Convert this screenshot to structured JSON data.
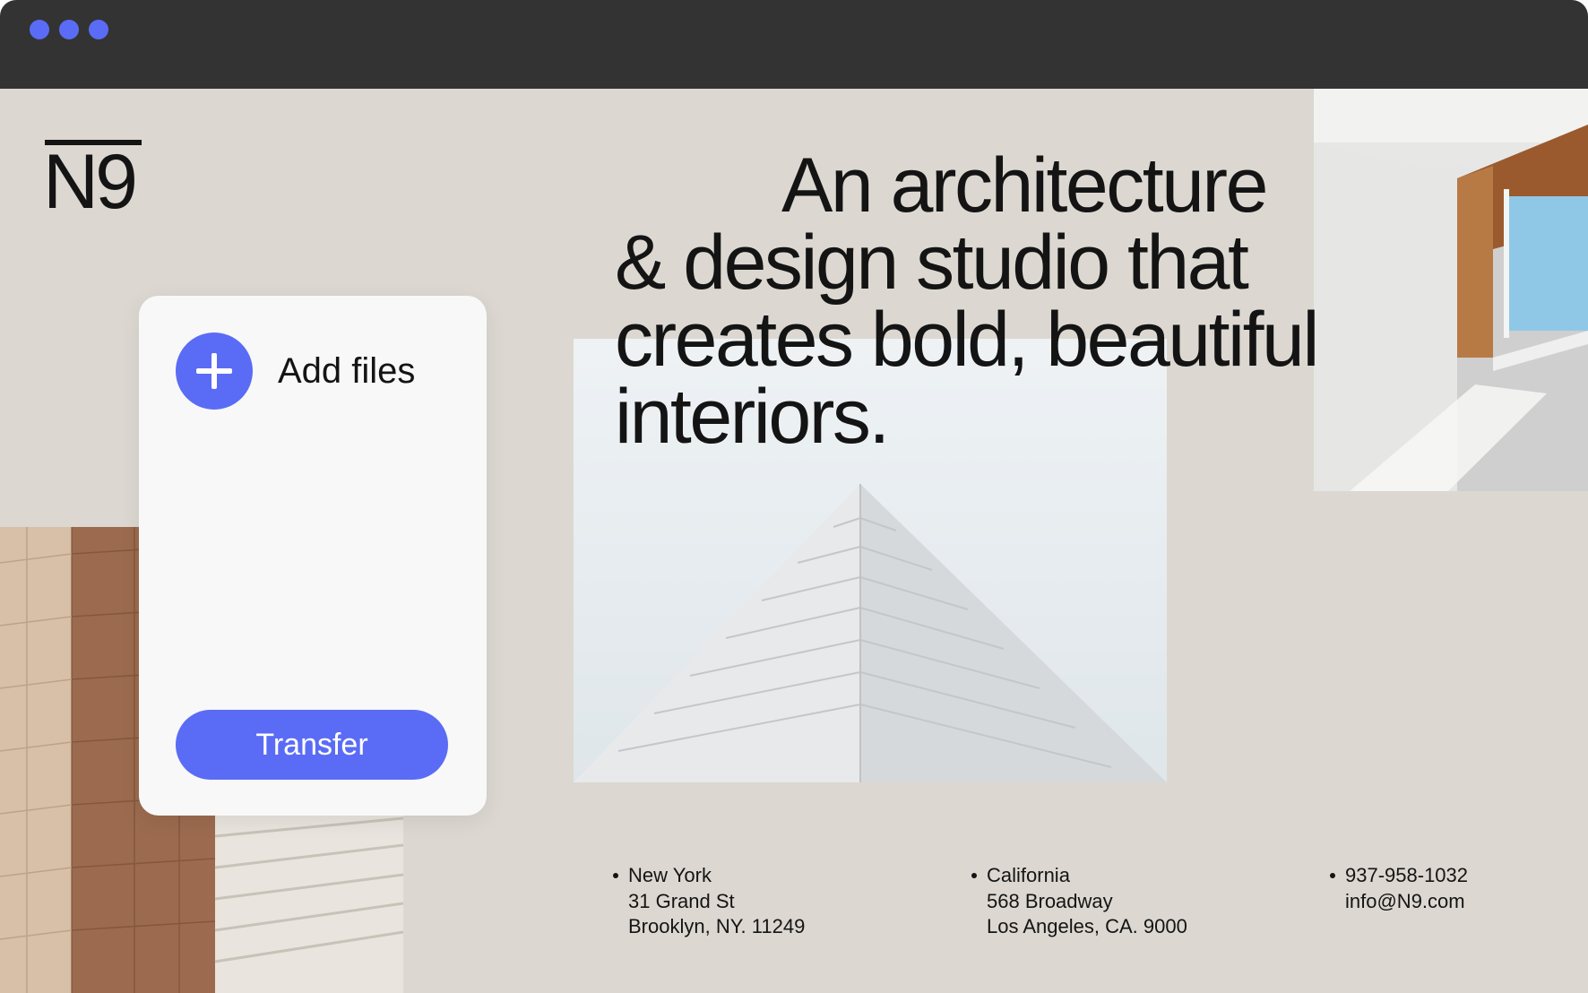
{
  "window": {
    "titlebar_dots": [
      "#5a6cf5",
      "#5a6cf5",
      "#5a6cf5"
    ]
  },
  "brand": {
    "logo": "N9"
  },
  "hero": {
    "lines": [
      "An architecture",
      "& design studio that",
      "creates bold, beautiful",
      "interiors."
    ]
  },
  "upload_card": {
    "add_label": "Add files",
    "transfer_label": "Transfer"
  },
  "contact": {
    "new_york": [
      "New York",
      "31 Grand St",
      "Brooklyn, NY. 11249"
    ],
    "california": [
      "California",
      "568 Broadway",
      "Los Angeles, CA. 9000"
    ],
    "reach": [
      "937-958-1032",
      "info@N9.com"
    ]
  },
  "colors": {
    "accent": "#5a6cf5",
    "background": "#dcd8d1",
    "titlebar": "#333333",
    "text": "#141414"
  },
  "icons": {
    "add": "plus-icon"
  }
}
